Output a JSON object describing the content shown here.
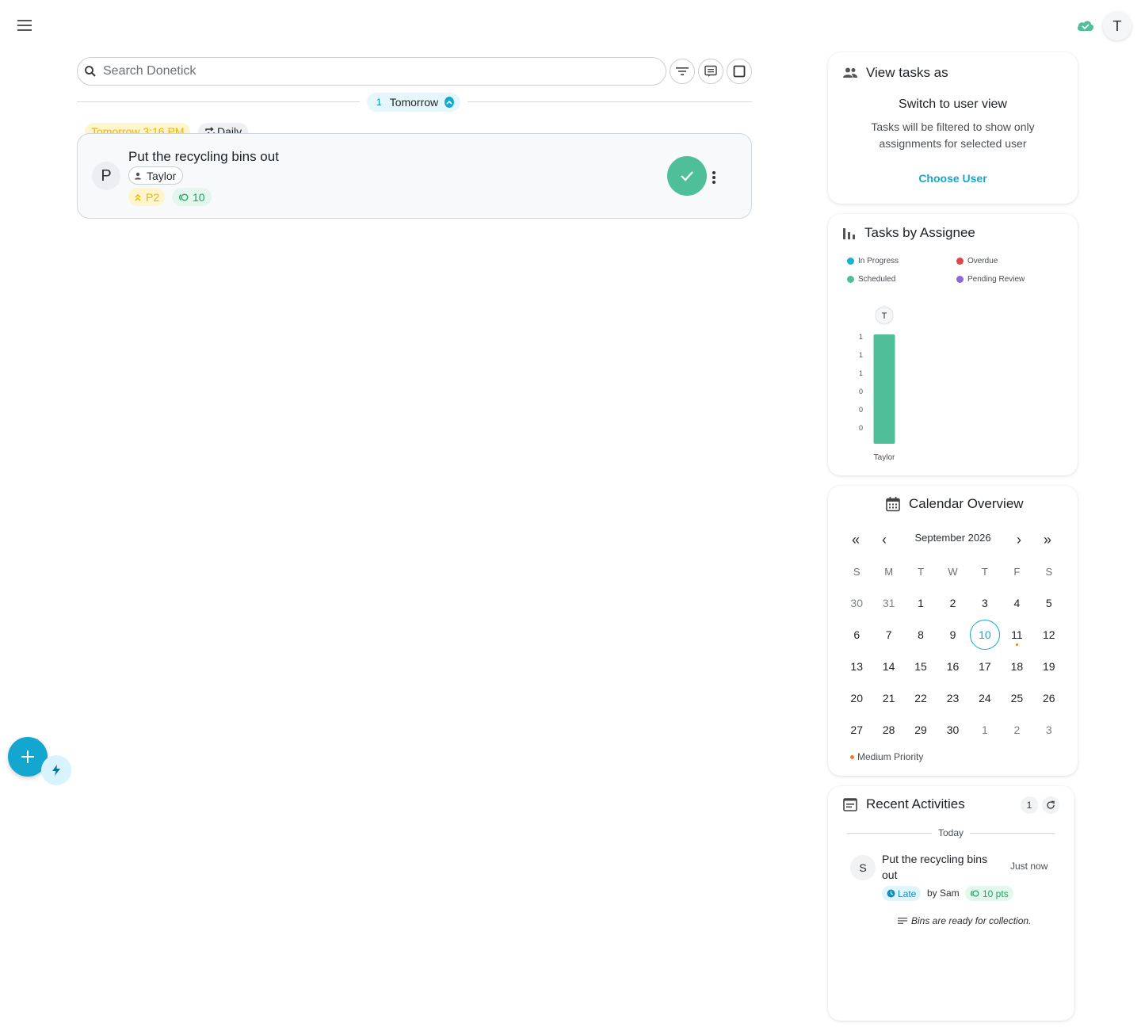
{
  "header": {
    "avatar_initial": "T",
    "sync_status_icon": "cloud-check-icon",
    "menu_icon": "hamburger-menu-icon"
  },
  "search": {
    "placeholder": "Search Donetick"
  },
  "toolbar": {
    "filter_icon": "filter-icon",
    "view_icon": "comment-view-icon",
    "select_icon": "select-square-icon"
  },
  "group": {
    "count": "1",
    "label": "Tomorrow"
  },
  "task": {
    "due": "Tomorrow 3:16 PM",
    "frequency": "Daily",
    "avatar_initial": "P",
    "title": "Put the recycling bins out",
    "assignee": "Taylor",
    "priority": "P2",
    "points": "10"
  },
  "view_as": {
    "title": "View tasks as",
    "subtitle": "Switch to user view",
    "description": "Tasks will be filtered to show only assignments for selected user",
    "action": "Choose User"
  },
  "assignee_chart": {
    "title": "Tasks by Assignee",
    "legend": [
      {
        "label": "In Progress",
        "color": "#17b2cf"
      },
      {
        "label": "Overdue",
        "color": "#e0474c"
      },
      {
        "label": "Scheduled",
        "color": "#4fbf9a"
      },
      {
        "label": "Pending Review",
        "color": "#8a6ad6"
      }
    ],
    "avatar_initial": "T"
  },
  "chart_data": {
    "type": "bar",
    "title": "Tasks by Assignee",
    "categories": [
      "Taylor"
    ],
    "series": [
      {
        "name": "Scheduled",
        "values": [
          1
        ],
        "color": "#4fbf9a"
      }
    ],
    "y_tick_labels": [
      "1",
      "1",
      "1",
      "0",
      "0",
      "0"
    ],
    "ylim": [
      0,
      1
    ],
    "legend_position": "top"
  },
  "calendar": {
    "title": "Calendar Overview",
    "month": "September 2026",
    "nav": {
      "first": "«",
      "prev": "‹",
      "next": "›",
      "last": "»"
    },
    "weekdays": [
      "S",
      "M",
      "T",
      "W",
      "T",
      "F",
      "S"
    ],
    "days": [
      {
        "d": "30",
        "other": true
      },
      {
        "d": "31",
        "other": true
      },
      {
        "d": "1"
      },
      {
        "d": "2"
      },
      {
        "d": "3"
      },
      {
        "d": "4"
      },
      {
        "d": "5"
      },
      {
        "d": "6"
      },
      {
        "d": "7"
      },
      {
        "d": "8"
      },
      {
        "d": "9"
      },
      {
        "d": "10",
        "today": true
      },
      {
        "d": "11",
        "marked": true
      },
      {
        "d": "12"
      },
      {
        "d": "13"
      },
      {
        "d": "14"
      },
      {
        "d": "15"
      },
      {
        "d": "16"
      },
      {
        "d": "17"
      },
      {
        "d": "18"
      },
      {
        "d": "19"
      },
      {
        "d": "20"
      },
      {
        "d": "21"
      },
      {
        "d": "22"
      },
      {
        "d": "23"
      },
      {
        "d": "24"
      },
      {
        "d": "25"
      },
      {
        "d": "26"
      },
      {
        "d": "27"
      },
      {
        "d": "28"
      },
      {
        "d": "29"
      },
      {
        "d": "30"
      },
      {
        "d": "1",
        "other": true
      },
      {
        "d": "2",
        "other": true
      },
      {
        "d": "3",
        "other": true
      }
    ],
    "legend": "Medium Priority",
    "legend_color": "#f07c1a"
  },
  "activities": {
    "title": "Recent Activities",
    "count": "1",
    "section": "Today",
    "items": [
      {
        "avatar_initial": "S",
        "title": "Put the recycling bins out",
        "time": "Just now",
        "status": "Late",
        "by": "by Sam",
        "points": "10 pts",
        "note": "Bins are ready for collection."
      }
    ]
  }
}
